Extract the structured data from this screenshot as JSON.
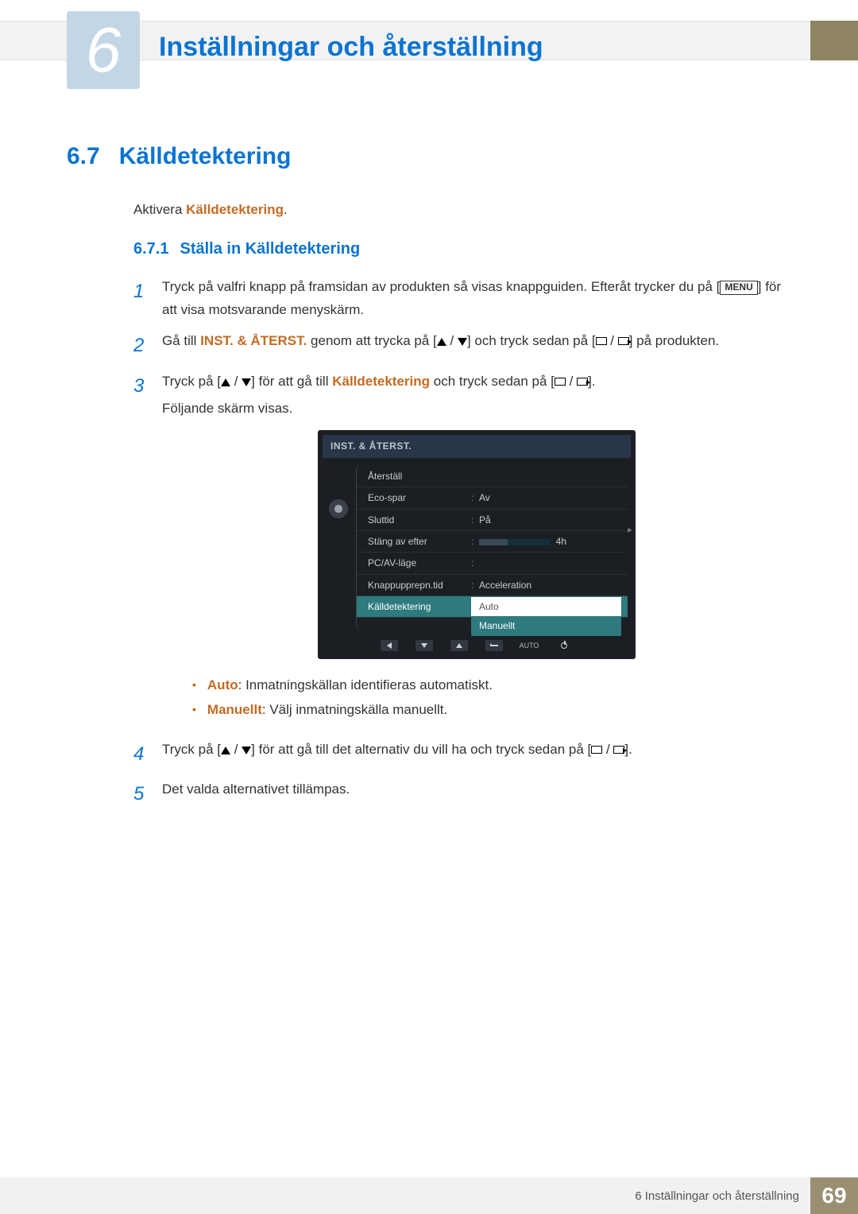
{
  "chapter": {
    "number": "6",
    "title": "Inställningar och återställning"
  },
  "section": {
    "number": "6.7",
    "title": "Källdetektering"
  },
  "intro": {
    "prefix": "Aktivera ",
    "highlight": "Källdetektering",
    "suffix": "."
  },
  "subsection": {
    "number": "6.7.1",
    "title": "Ställa in Källdetektering"
  },
  "steps": {
    "s1": {
      "num": "1",
      "a": "Tryck på valfri knapp på framsidan av produkten så visas knappguiden. Efteråt trycker du på [",
      "menu": "MENU",
      "b": "] för att visa motsvarande menyskärm."
    },
    "s2": {
      "num": "2",
      "a": "Gå till ",
      "hl": "INST. & ÅTERST.",
      "b": " genom att trycka på [",
      "c": "] och tryck sedan på [",
      "d": "] på produkten."
    },
    "s3": {
      "num": "3",
      "a": "Tryck på [",
      "b": "] för att gå till ",
      "hl": "Källdetektering",
      "c": " och tryck sedan på [",
      "d": "].",
      "follow": "Följande skärm visas."
    },
    "s4": {
      "num": "4",
      "a": "Tryck på [",
      "b": "] för att gå till det alternativ du vill ha och tryck sedan på [",
      "c": "]."
    },
    "s5": {
      "num": "5",
      "text": "Det valda alternativet tillämpas."
    }
  },
  "osd": {
    "title": "INST. & ÅTERST.",
    "items": [
      {
        "label": "Återställ",
        "value": ""
      },
      {
        "label": "Eco-spar",
        "value": "Av"
      },
      {
        "label": "Sluttid",
        "value": "På"
      },
      {
        "label": "Stäng av efter",
        "value": "",
        "bar": true,
        "extra": "4h"
      },
      {
        "label": "PC/AV-läge",
        "value": ""
      },
      {
        "label": "Knappupprepn.tid",
        "value": "Acceleration"
      },
      {
        "label": "Källdetektering",
        "value": "Auto",
        "selected": true
      }
    ],
    "dropdown": {
      "opt_hl": "Auto",
      "opt2": "Manuellt"
    },
    "footer_auto": "AUTO"
  },
  "bullets": {
    "b1": {
      "hl": "Auto",
      "text": ": Inmatningskällan identifieras automatiskt."
    },
    "b2": {
      "hl": "Manuellt",
      "text": ": Välj inmatningskälla manuellt."
    }
  },
  "footer": {
    "text": "6 Inställningar och återställning",
    "page": "69"
  }
}
